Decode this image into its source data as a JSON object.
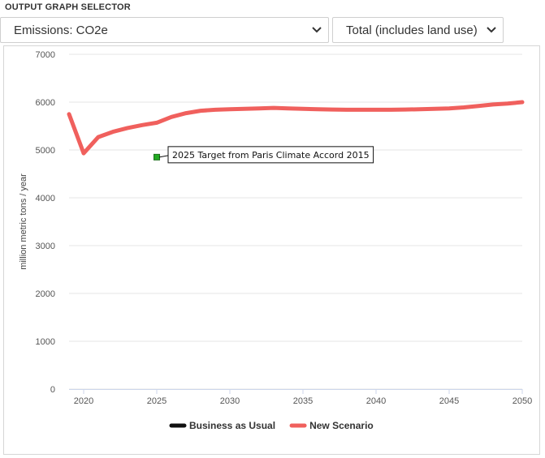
{
  "header": {
    "title": "OUTPUT GRAPH SELECTOR"
  },
  "selectors": {
    "emission": {
      "value": "Emissions: CO2e"
    },
    "scope": {
      "value": "Total (includes land use)"
    }
  },
  "colors": {
    "new_scenario": "#f0605d",
    "business_as_usual": "#111111",
    "target_marker": "#22aa22",
    "grid": "#e6e6e6"
  },
  "chart_data": {
    "type": "line",
    "title": "",
    "xlabel": "",
    "ylabel": "million metric tons / year",
    "xlim": [
      2019,
      2050
    ],
    "ylim": [
      0,
      7000
    ],
    "yticks": [
      0,
      1000,
      2000,
      3000,
      4000,
      5000,
      6000,
      7000
    ],
    "xticks": [
      2020,
      2025,
      2030,
      2035,
      2040,
      2045,
      2050
    ],
    "grid": true,
    "legend_position": "bottom",
    "series": [
      {
        "name": "Business as Usual",
        "color": "#111111",
        "x": [
          2019,
          2020,
          2021,
          2022,
          2023,
          2024,
          2025,
          2026,
          2027,
          2028,
          2029,
          2030,
          2031,
          2032,
          2033,
          2034,
          2035,
          2036,
          2037,
          2038,
          2039,
          2040,
          2041,
          2042,
          2043,
          2044,
          2045,
          2046,
          2047,
          2048,
          2049,
          2050
        ],
        "y": [
          5750,
          4930,
          5270,
          5380,
          5460,
          5520,
          5570,
          5690,
          5770,
          5820,
          5840,
          5850,
          5860,
          5870,
          5880,
          5870,
          5860,
          5850,
          5845,
          5840,
          5840,
          5840,
          5840,
          5845,
          5850,
          5860,
          5870,
          5890,
          5920,
          5950,
          5970,
          6000
        ]
      },
      {
        "name": "New Scenario",
        "color": "#f0605d",
        "x": [
          2019,
          2020,
          2021,
          2022,
          2023,
          2024,
          2025,
          2026,
          2027,
          2028,
          2029,
          2030,
          2031,
          2032,
          2033,
          2034,
          2035,
          2036,
          2037,
          2038,
          2039,
          2040,
          2041,
          2042,
          2043,
          2044,
          2045,
          2046,
          2047,
          2048,
          2049,
          2050
        ],
        "y": [
          5750,
          4930,
          5270,
          5380,
          5460,
          5520,
          5570,
          5690,
          5770,
          5820,
          5840,
          5850,
          5860,
          5870,
          5880,
          5870,
          5860,
          5850,
          5845,
          5840,
          5840,
          5840,
          5840,
          5845,
          5850,
          5860,
          5870,
          5890,
          5920,
          5950,
          5970,
          6000
        ]
      }
    ],
    "annotations": [
      {
        "x": 2025,
        "y": 4850,
        "text": "2025 Target from Paris Climate Accord 2015"
      }
    ]
  }
}
